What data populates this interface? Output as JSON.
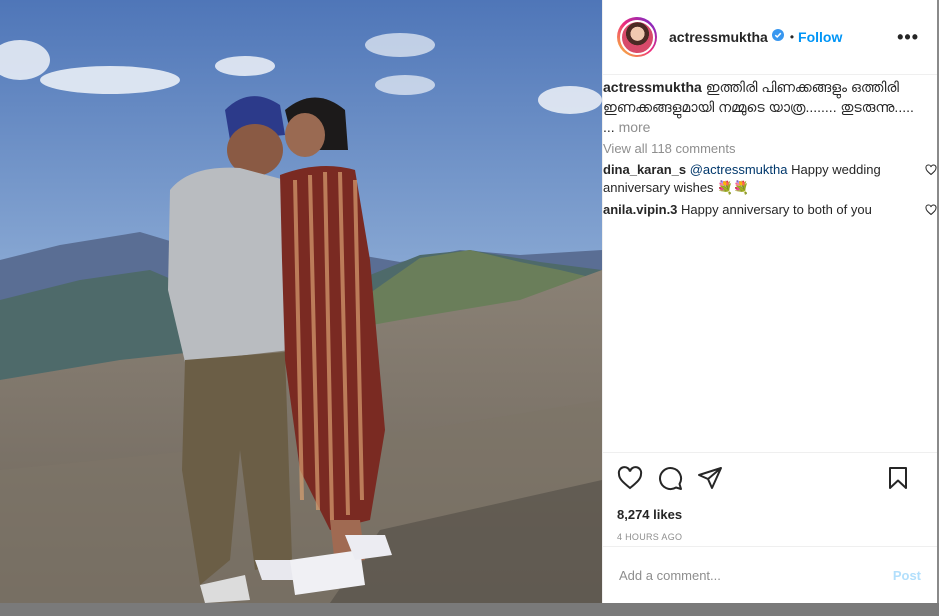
{
  "post": {
    "username": "actressmuktha",
    "follow_label": "Follow",
    "separator": "•",
    "more_options": "•••"
  },
  "caption": {
    "username": "actressmuktha",
    "text": "ഇത്തിരി പിണക്കങ്ങളും ഒത്തിരി ഇണക്കങ്ങളുമായി നമ്മുടെ യാത്ര........ തുടരുന്നു..... ...",
    "more": "more"
  },
  "view_all": "View all 118 comments",
  "comments": [
    {
      "username": "dina_karan_s",
      "mention": "@actressmuktha",
      "text": "Happy wedding anniversary wishes 💐💐"
    },
    {
      "username": "anila.vipin.3",
      "mention": "",
      "text": "Happy anniversary to both of you"
    }
  ],
  "likes": "8,274 likes",
  "timestamp": "4 HOURS AGO",
  "add_comment": {
    "placeholder": "Add a comment...",
    "post_label": "Post"
  },
  "colors": {
    "accent": "#0095f6",
    "verified": "#3897f0",
    "post_disabled": "#b2dffc"
  },
  "icons": [
    "heart-icon",
    "comment-icon",
    "share-icon",
    "bookmark-icon",
    "verified-badge-icon",
    "more-options-icon"
  ]
}
